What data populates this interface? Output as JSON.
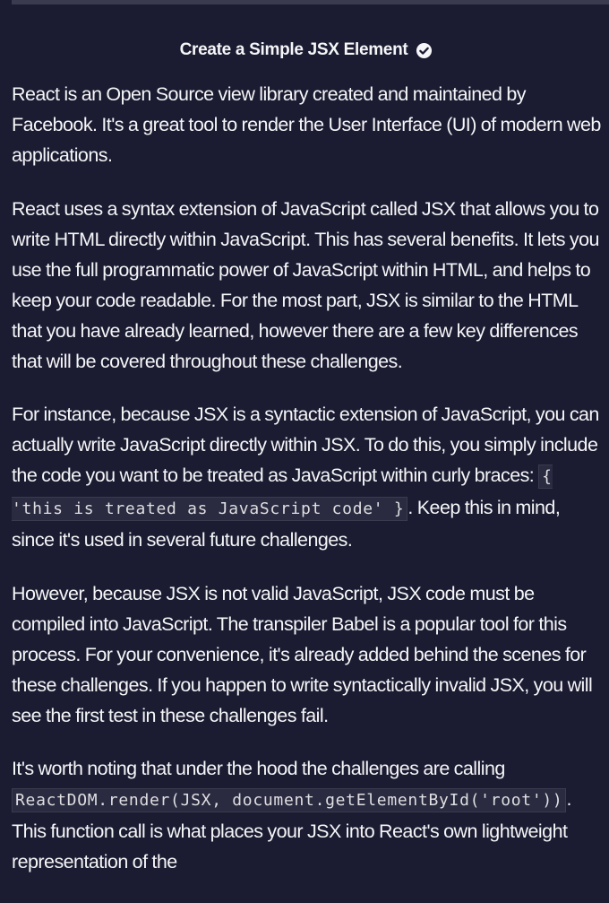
{
  "header": {
    "title": "Create a Simple JSX Element",
    "completed_icon": "check-circle-icon"
  },
  "description": {
    "p1": "React is an Open Source view library created and maintained by Facebook. It's a great tool to render the User Interface (UI) of modern web applications.",
    "p2": "React uses a syntax extension of JavaScript called JSX that allows you to write HTML directly within JavaScript. This has several benefits. It lets you use the full programmatic power of JavaScript within HTML, and helps to keep your code readable. For the most part, JSX is similar to the HTML that you have already learned, however there are a few key differences that will be covered throughout these challenges.",
    "p3_before": "For instance, because JSX is a syntactic extension of JavaScript, you can actually write JavaScript directly within JSX. To do this, you simply include the code you want to be treated as JavaScript within curly braces: ",
    "p3_code": "{ 'this is treated as JavaScript code' }",
    "p3_after": ". Keep this in mind, since it's used in several future challenges.",
    "p4": "However, because JSX is not valid JavaScript, JSX code must be compiled into JavaScript. The transpiler Babel is a popular tool for this process. For your convenience, it's already added behind the scenes for these challenges. If you happen to write syntactically invalid JSX, you will see the first test in these challenges fail.",
    "p5_before": "It's worth noting that under the hood the challenges are calling ",
    "p5_code": "ReactDOM.render(JSX, document.getElementById('root'))",
    "p5_after": ". This function call is what places your JSX into React's own lightweight representation of the"
  },
  "colors": {
    "background": "#1b1b32",
    "text": "#f5f6f7",
    "code_background": "#2a2a40",
    "code_border": "#3b3b4f"
  }
}
